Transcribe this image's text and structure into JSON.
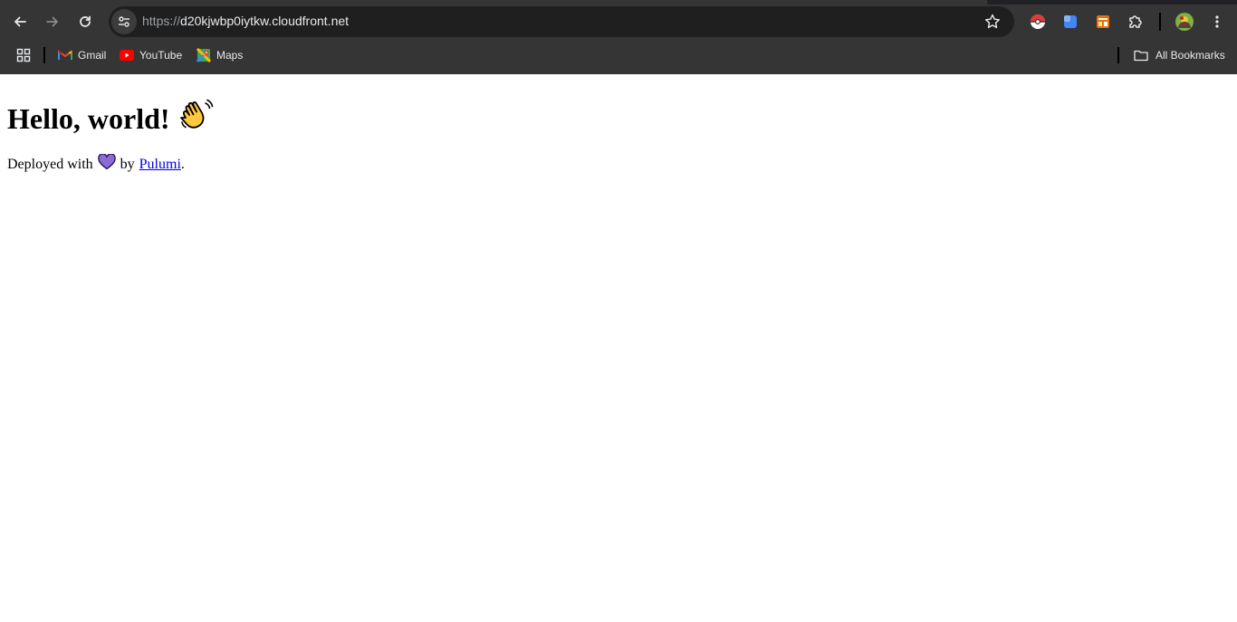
{
  "browser": {
    "url_scheme": "https://",
    "url_host": "d20kjwbp0iytkw.cloudfront.net"
  },
  "bookmarks": {
    "items": [
      {
        "label": "Gmail",
        "icon": "gmail-icon"
      },
      {
        "label": "YouTube",
        "icon": "youtube-icon"
      },
      {
        "label": "Maps",
        "icon": "maps-icon"
      }
    ],
    "all_bookmarks_label": "All Bookmarks"
  },
  "page": {
    "heading": "Hello, world!",
    "heading_emoji": "waving-hand",
    "deployed_prefix": "Deployed with",
    "heart_emoji": "purple-heart",
    "deployed_by": "by",
    "link_text": "Pulumi",
    "period": "."
  },
  "colors": {
    "chrome_bg": "#353535",
    "omnibox_bg": "#1f1f1f",
    "link": "#0000ee",
    "heart": "#8a6bd8"
  }
}
